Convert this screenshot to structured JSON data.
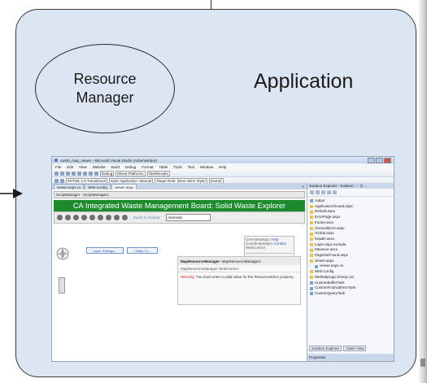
{
  "diagram": {
    "resource_manager_label": "Resource\nManager",
    "application_label": "Application"
  },
  "ide": {
    "window_title": "cwmb_map_viewer - Microsoft Visual Studio (Administrator)",
    "menu": [
      "File",
      "Edit",
      "View",
      "Website",
      "Build",
      "Debug",
      "Format",
      "Table",
      "Tools",
      "Test",
      "Window",
      "Help"
    ],
    "toolbar": {
      "debug_config": "Debug",
      "platform": "Mixed Platforms",
      "find_target": "TaskResults",
      "doctype": "XHTML 1.0 Transitional",
      "style_application": "Style Application: Manual",
      "target_rule": "Target Rule: (New Inline Style)",
      "font_size": "(None)"
    },
    "doc_tabs": [
      "viewer.aspx.cs",
      "Web.Config",
      "viewer.aspx"
    ],
    "script_manager": "ScriptManager - ScriptManager1",
    "banner_title": "CA Integrated Waste Management Board: Solid Waste Explorer",
    "zoom_to_county": "Zoom to County:",
    "county_value": "Alameda",
    "webcontrol": {
      "line1": "OverviewMap1",
      "help": "Help",
      "line2": "CoordinateMap1",
      "contact": "Contact",
      "line3": "WebControl"
    },
    "layer_settings_button": "Layer Settings...",
    "i_want_to_button": "I Want To...",
    "resource_panel": {
      "title": "MapResourceManager",
      "title_suffix": " - MapResourceManager1",
      "subtitle": "MapResourceManager WebControl",
      "warning_label": "Warning:",
      "warning_text": " You must enter a valid value for the ResourceItems property."
    },
    "solution_explorer": {
      "header": "Solution Explorer - Solution '...' (1 ...",
      "items": [
        "output",
        "ApplicationClosed.aspx",
        "Default.aspx",
        "ErrorPage.aspx",
        "Footer.ascx",
        "GeneralError.aspx",
        "Global.asax",
        "header.ascx",
        "Login.aspx.exclude",
        "Measure.ascx",
        "PageNotFound.aspx",
        "viewer.aspx",
        "viewer.aspx.cs",
        "Web.Config",
        "WebMapApp.Sheep.css",
        "CustomBufferTask",
        "CustomFindAddressTask",
        "CustomQueryTask"
      ],
      "tab_solution_explorer": "Solution Explorer",
      "tab_class_view": "Class View",
      "properties_label": "Properties"
    }
  }
}
